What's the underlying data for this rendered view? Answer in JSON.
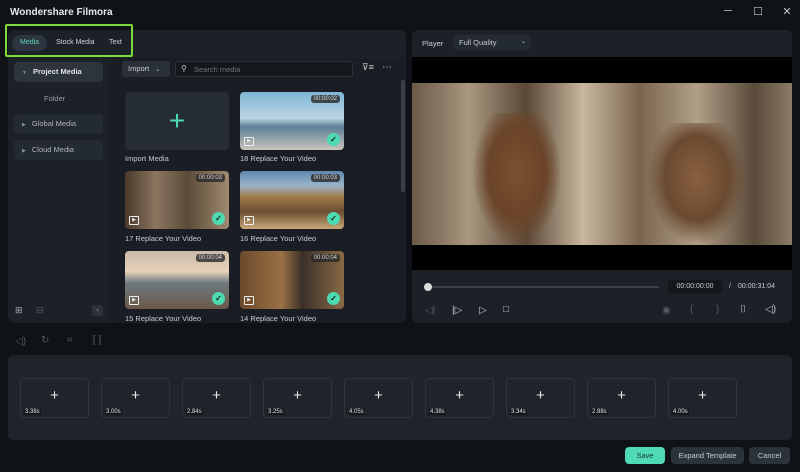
{
  "app": {
    "title": "Wondershare Filmora",
    "minimize": "─",
    "maximize": "☐",
    "close": "✕"
  },
  "tabs": [
    "Media",
    "Stock Media",
    "Text"
  ],
  "sidebar": {
    "items": [
      "Project Media",
      "Folder",
      "Global Media",
      "Cloud Media"
    ]
  },
  "toolbar": {
    "import_label": "Import",
    "search_placeholder": "Search media"
  },
  "media": [
    {
      "label": "Import Media"
    },
    {
      "label": "18 Replace Your Video",
      "duration": "00:00:02"
    },
    {
      "label": "17 Replace Your Video",
      "duration": "00:00:03"
    },
    {
      "label": "16 Replace Your Video",
      "duration": "00:00:03"
    },
    {
      "label": "15 Replace Your Video",
      "duration": "00:00:04"
    },
    {
      "label": "14 Replace Your Video",
      "duration": "00:00:04"
    }
  ],
  "player": {
    "label": "Player",
    "quality": "Full Quality",
    "current_time": "00:00:00:00",
    "separator": "/",
    "total_time": "00:00:31:04",
    "progress": 0
  },
  "clips": [
    "3.38s",
    "3.00s",
    "2.84s",
    "3.25s",
    "4.05s",
    "4.38s",
    "3.34s",
    "2.88s",
    "4.00s"
  ],
  "footer": {
    "save": "Save",
    "expand": "Expand Template",
    "cancel": "Cancel"
  },
  "colors": {
    "accent": "#4fd9b5",
    "highlight": "#7ed93a"
  }
}
